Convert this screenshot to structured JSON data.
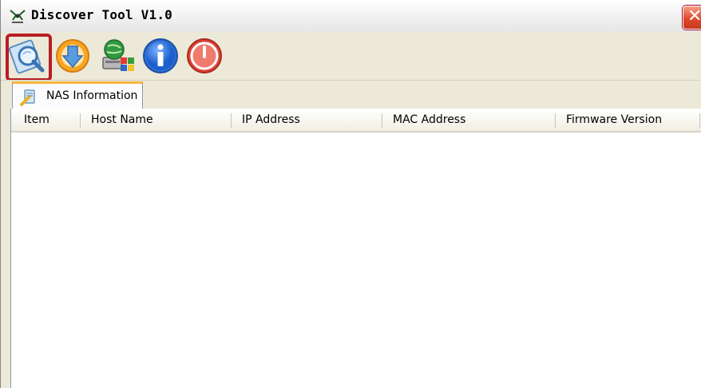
{
  "window": {
    "title": "Discover Tool V1.0",
    "close_icon": "close-icon"
  },
  "toolbar": {
    "buttons": [
      {
        "icon": "search-nas-icon",
        "highlighted": true
      },
      {
        "icon": "download-icon"
      },
      {
        "icon": "network-settings-icon"
      },
      {
        "icon": "info-icon"
      },
      {
        "icon": "power-icon"
      }
    ],
    "highlight_color": "#b81d25"
  },
  "tabs": [
    {
      "label": "NAS Information",
      "active": true
    }
  ],
  "list": {
    "columns": [
      "Item",
      "Host Name",
      "IP Address",
      "MAC Address",
      "Firmware Version"
    ],
    "rows": []
  },
  "colors": {
    "tab_accent": "#f7b63c",
    "close_button": "#e0492b"
  }
}
